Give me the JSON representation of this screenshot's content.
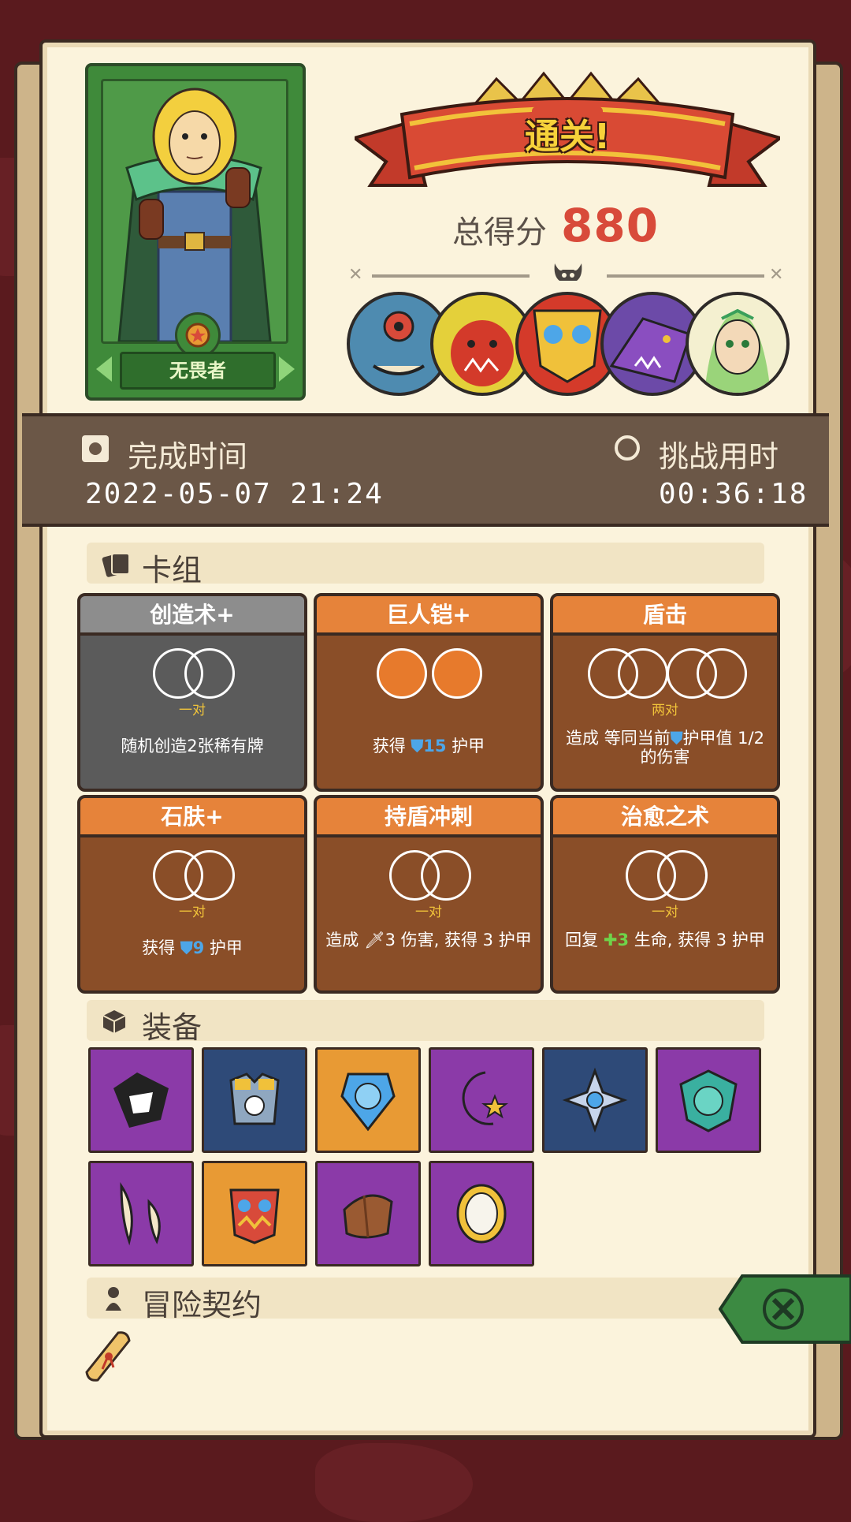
{
  "hero": {
    "name": "无畏者"
  },
  "header": {
    "title": "通关!",
    "score_label": "总得分",
    "score_value": "880"
  },
  "bosses": [
    {
      "name": "cyclops-ogre-boss"
    },
    {
      "name": "red-demon-boss"
    },
    {
      "name": "golden-mask-boss"
    },
    {
      "name": "purple-dragon-boss"
    },
    {
      "name": "elf-queen-boss"
    }
  ],
  "times": {
    "complete_label": "完成时间",
    "complete_value": "2022-05-07  21:24",
    "challenge_label": "挑战用时",
    "challenge_value": "00:36:18"
  },
  "sections": {
    "deck": "卡组",
    "equipment": "装备",
    "contract": "冒险契约"
  },
  "deck": [
    {
      "title": "创造术+",
      "req": "一对",
      "desc_pre": "随机创造2张稀有牌",
      "desc_num": "",
      "desc_post": ""
    },
    {
      "title": "巨人铠+",
      "req": "",
      "desc_pre": "获得 ",
      "desc_num": "15",
      "desc_post": " 护甲"
    },
    {
      "title": "盾击",
      "req": "两对",
      "desc_pre": "造成 等同当前",
      "desc_num": "",
      "desc_post": "护甲值 1/2 的伤害"
    },
    {
      "title": "石肤+",
      "req": "一对",
      "desc_pre": "获得 ",
      "desc_num": "9",
      "desc_post": " 护甲"
    },
    {
      "title": "持盾冲刺",
      "req": "一对",
      "desc_pre": "造成 ",
      "desc_num": "3",
      "desc_post": " 伤害, 获得 3 护甲"
    },
    {
      "title": "治愈之术",
      "req": "一对",
      "desc_pre": "回复 ",
      "desc_num": "3",
      "desc_post": " 生命, 获得 3 护甲"
    }
  ],
  "colors": {
    "background": "#5a1a1e",
    "page": "#fbf3dc",
    "accent_red": "#d84a3a",
    "card_orange": "#e6833a",
    "card_brown": "#8a4e28",
    "shield_blue": "#4da6e8"
  },
  "equipment": [
    {
      "icon": "torn-beast-icon",
      "color": "purple"
    },
    {
      "icon": "chest-armor-icon",
      "color": "blue"
    },
    {
      "icon": "pumpkin-shield-icon",
      "color": "orange"
    },
    {
      "icon": "moon-star-wand-icon",
      "color": "purple"
    },
    {
      "icon": "cross-emblem-icon",
      "color": "blue"
    },
    {
      "icon": "lion-crest-icon",
      "color": "purple"
    },
    {
      "icon": "claw-fangs-icon",
      "color": "purple"
    },
    {
      "icon": "spiked-chestplate-icon",
      "color": "orange"
    },
    {
      "icon": "leather-bracer-icon",
      "color": "purple"
    },
    {
      "icon": "golden-mirror-icon",
      "color": "purple"
    }
  ]
}
